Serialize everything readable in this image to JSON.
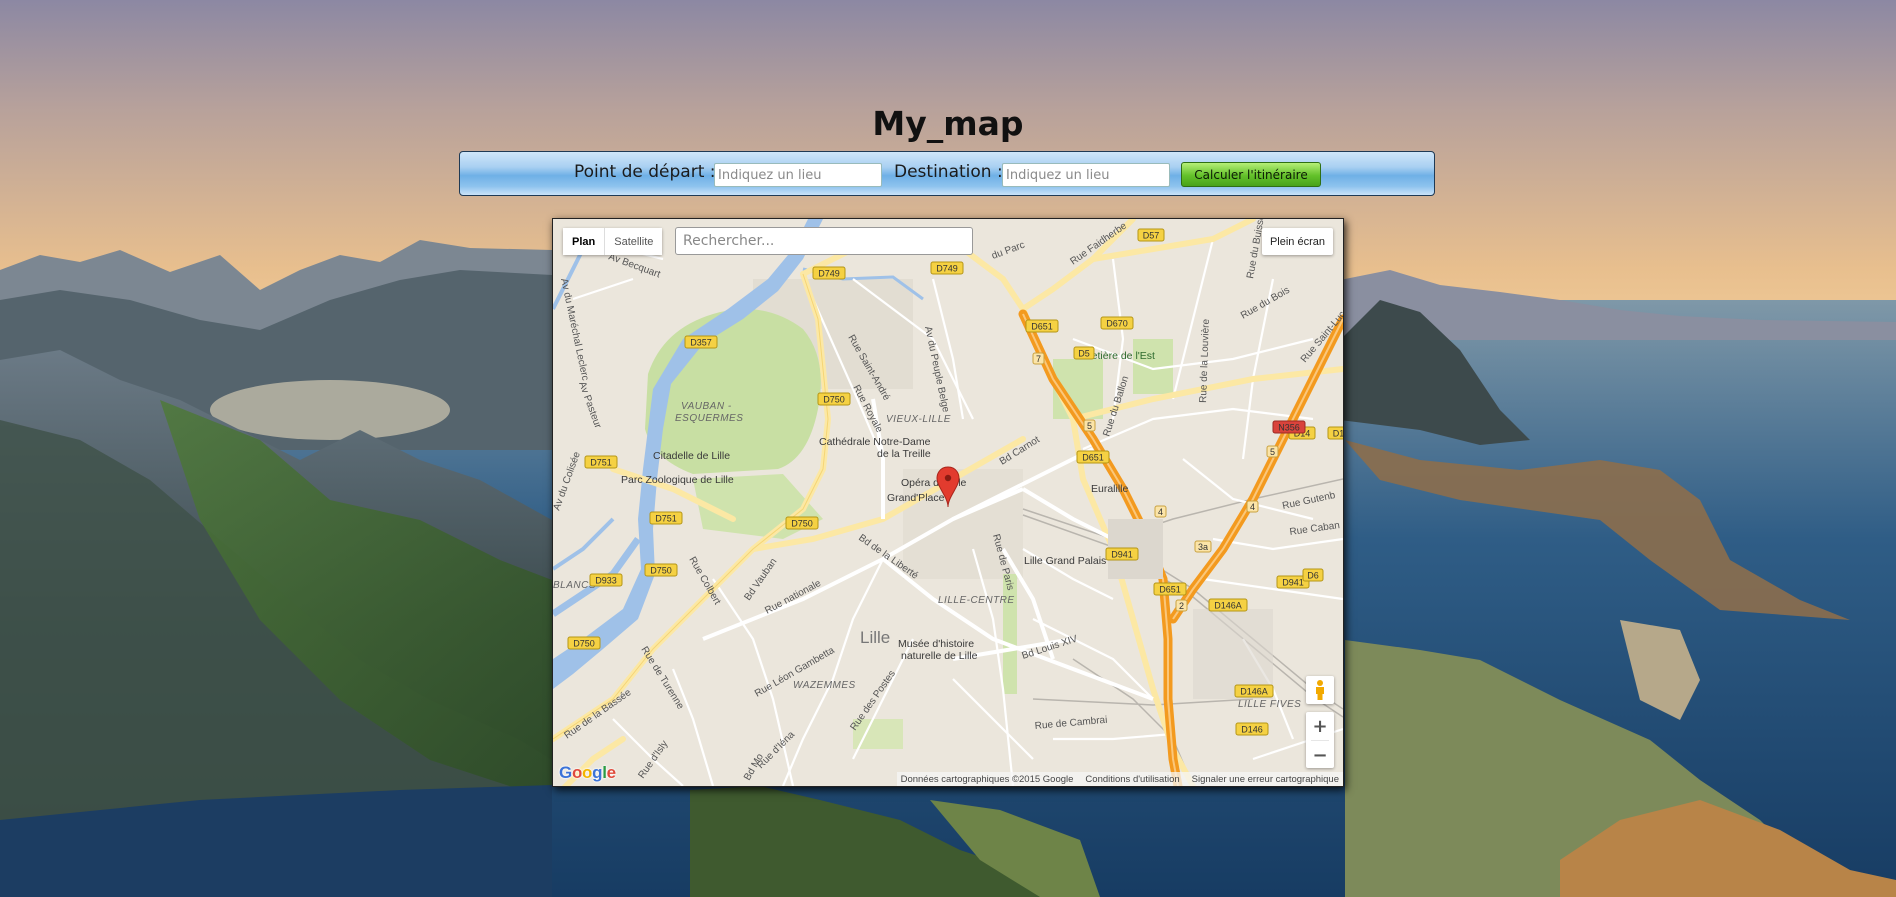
{
  "page": {
    "title": "My_map"
  },
  "route_form": {
    "start_label": "Point de départ :",
    "start_placeholder": "Indiquez un lieu",
    "destination_label": "Destination :",
    "destination_placeholder": "Indiquez un lieu",
    "submit_label": "Calculer l'itinéraire"
  },
  "map": {
    "map_types": [
      "Plan",
      "Satellite"
    ],
    "active_map_type": "Plan",
    "search_placeholder": "Rechercher...",
    "fullscreen_label": "Plein écran",
    "zoom_in": "+",
    "zoom_out": "−",
    "logo": [
      "G",
      "o",
      "o",
      "g",
      "l",
      "e"
    ],
    "attribution": {
      "data": "Données cartographiques ©2015 Google",
      "terms": "Conditions d'utilisation",
      "report": "Signaler une erreur cartographique"
    },
    "labels": {
      "city": "Lille",
      "vauban_1": "VAUBAN -",
      "vauban_2": "ESQUERMES",
      "vieux_lille": "VIEUX-LILLE",
      "lille_centre": "LILLE-CENTRE",
      "wazemmes": "WAZEMMES",
      "lille_fives": "LILLE FIVES",
      "blancs": "BLANCS",
      "citadelle": "Citadelle de Lille",
      "zoo": "Parc Zoologique de Lille",
      "cathedrale_1": "Cathédrale Notre-Dame",
      "cathedrale_2": "de la Treille",
      "opera": "Opéra de Lille",
      "grand_place": "Grand'Place",
      "euralille": "Euralille",
      "grand_palais": "Lille Grand Palais",
      "cimetiere": "Cimetière de l'Est",
      "musee_1": "Musée d'histoire",
      "musee_2": "naturelle de Lille",
      "av_becquart": "Av Becquart",
      "av_marechal": "Av du Maréchal Leclerc",
      "av_pasteur": "Av Pasteur",
      "av_colisee": "Av du Colisée",
      "rue_saint_andre": "Rue Saint-André",
      "rue_royale": "Rue Royale",
      "av_peuple_belge": "Av du Peuple Belge",
      "bd_carnot": "Bd Carnot",
      "rue_du_ballon": "Rue du Ballon",
      "rue_louviere": "Rue de la Louvière",
      "rue_du_bois": "Rue du Bois",
      "rue_saint_luc": "Rue Saint-Luc",
      "rue_faidherbe": "Rue Faidherbe",
      "rue_du_buisson": "Rue du Buisson",
      "du_parc": "du Parc",
      "bd_liberte": "Bd de la Liberté",
      "rue_nationale": "Rue nationale",
      "bd_vauban": "Bd Vauban",
      "rue_colbert": "Rue Colbert",
      "rue_turenne": "Rue de Turenne",
      "rue_bassee": "Rue de la Bassée",
      "rue_gambetta": "Rue Léon Gambetta",
      "rue_postes": "Rue des Postes",
      "rue_paris": "Rue de Paris",
      "bd_louis_xiv": "Bd Louis XIV",
      "rue_cambrai": "Rue de Cambrai",
      "rue_isly": "Rue d'Isly",
      "rue_iena": "Rue d'Iéna",
      "rue_gutenberg": "Rue Gutenb",
      "rue_cabanis": "Rue Caban",
      "bd_mo": "Bd Mo"
    },
    "road_shields": [
      "D57",
      "D749",
      "D749",
      "D670",
      "D651",
      "D5",
      "D357",
      "D750",
      "D14",
      "N356",
      "D14",
      "D751",
      "D651",
      "D751",
      "D750",
      "D941",
      "D941",
      "D933",
      "D750",
      "D651",
      "D6",
      "D146A",
      "D750",
      "D146A",
      "D146"
    ],
    "exit_numbers": [
      "7",
      "5",
      "5",
      "4",
      "4",
      "3a",
      "2"
    ]
  },
  "colors": {
    "accent_button": "#63c12a",
    "bar_blue": "#6fb0e6",
    "motorway": "#f39a1f",
    "park": "#c8dfa3",
    "water": "#9fc1e8",
    "marker": "#e23b2e"
  }
}
